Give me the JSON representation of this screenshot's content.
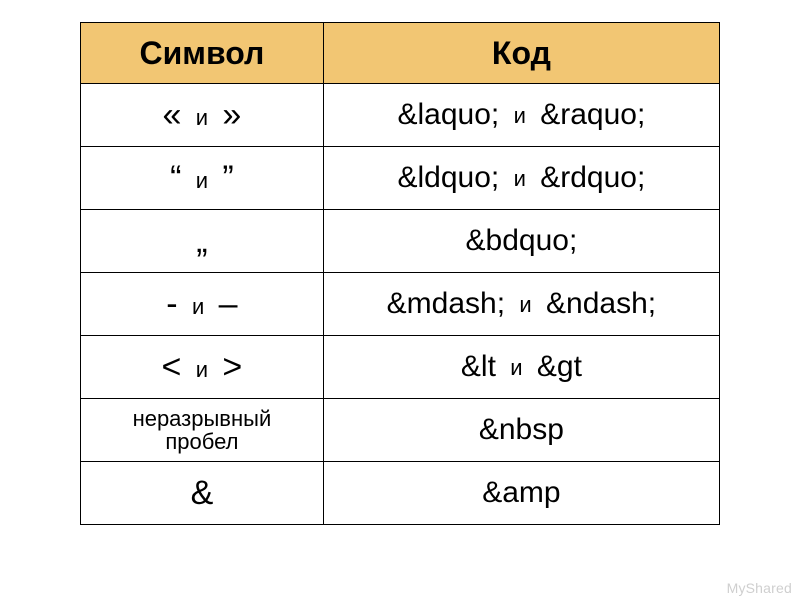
{
  "headers": {
    "symbol": "Символ",
    "code": "Код"
  },
  "separator": "и",
  "rows": [
    {
      "symbol_a": "«",
      "symbol_b": "»",
      "code_a": "&laquo;",
      "code_b": "&raquo;"
    },
    {
      "symbol_a": "“",
      "symbol_b": "”",
      "code_a": "&ldquo;",
      "code_b": "&rdquo;"
    },
    {
      "symbol_a": "„",
      "symbol_b": null,
      "code_a": "&bdquo;",
      "code_b": null
    },
    {
      "symbol_a": "-",
      "symbol_b": "–",
      "code_a": "&mdash;",
      "code_b": "&ndash;"
    },
    {
      "symbol_a": "<",
      "symbol_b": ">",
      "code_a": "&lt",
      "code_b": "&gt"
    },
    {
      "symbol_text": "неразрывный пробел",
      "code_a": "&nbsp",
      "code_b": null
    },
    {
      "symbol_a": "&",
      "symbol_b": null,
      "code_a": "&amp",
      "code_b": null
    }
  ],
  "watermark": "MyShared"
}
